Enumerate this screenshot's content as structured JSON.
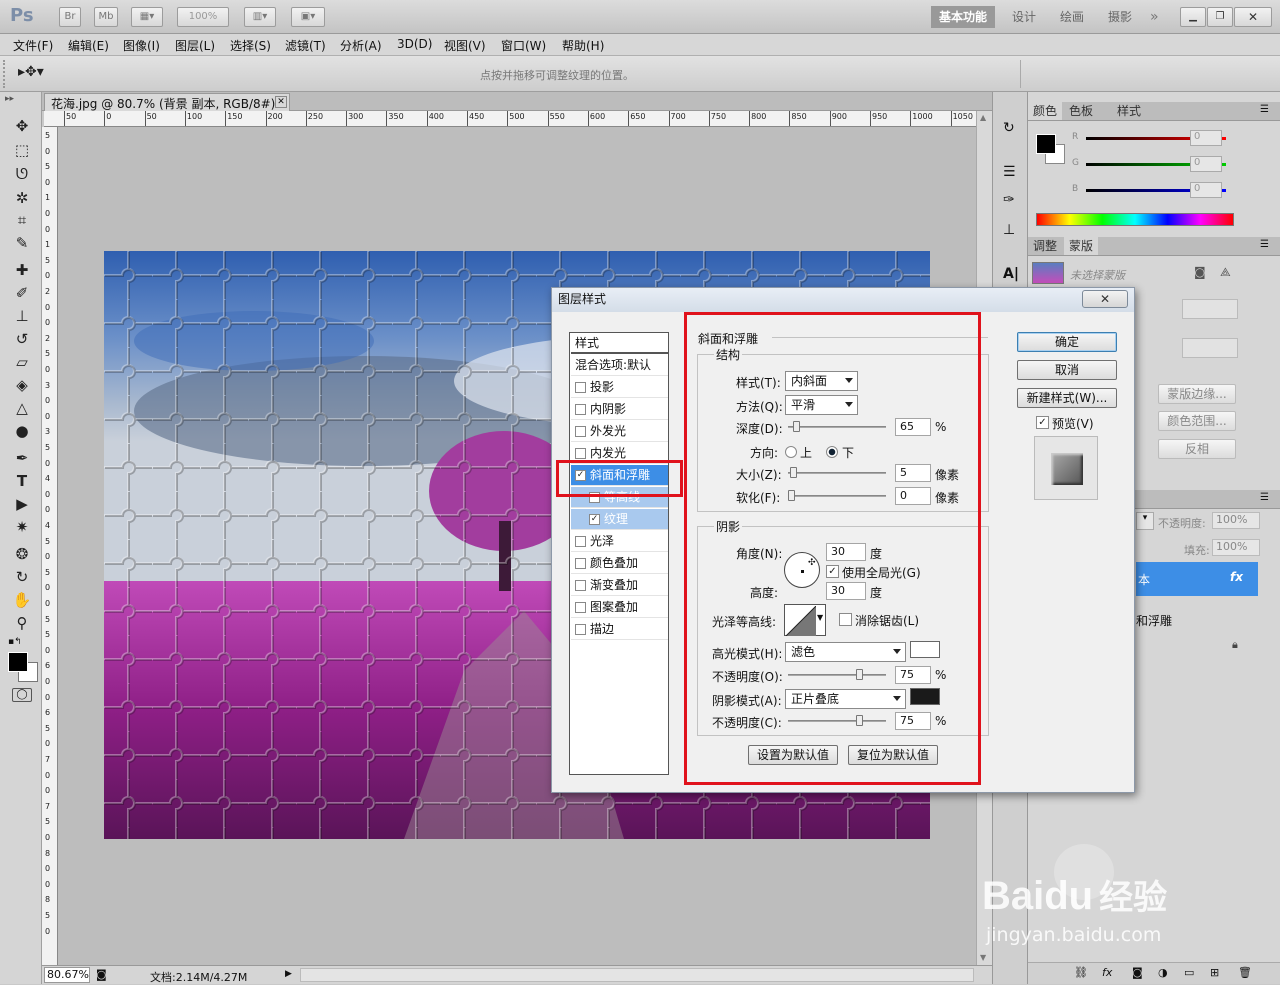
{
  "app": {
    "logo": "Ps",
    "zoom_display": "100%",
    "workspace": [
      "基本功能",
      "设计",
      "绘画",
      "摄影"
    ],
    "bridge_label": "Br",
    "minibridge_label": "Mb"
  },
  "menu": [
    "文件(F)",
    "编辑(E)",
    "图像(I)",
    "图层(L)",
    "选择(S)",
    "滤镜(T)",
    "分析(A)",
    "3D(D)",
    "视图(V)",
    "窗口(W)",
    "帮助(H)"
  ],
  "options_hint": "点按并拖移可调整纹理的位置。",
  "document": {
    "tab": "花海.jpg @ 80.7% (背景 副本, RGB/8#) *",
    "zoom": "80.67%",
    "doc_info": "文档:2.14M/4.27M",
    "ruler_h": [
      "50",
      "0",
      "50",
      "100",
      "150",
      "200",
      "250",
      "300",
      "350",
      "400",
      "450",
      "500",
      "550",
      "600",
      "650",
      "700",
      "750",
      "800",
      "850",
      "900",
      "950",
      "1000",
      "1050"
    ],
    "ruler_v": [
      "5",
      "0",
      "5",
      "0",
      "1",
      "0",
      "0",
      "1",
      "5",
      "0",
      "2",
      "0",
      "0",
      "2",
      "5",
      "0",
      "3",
      "0",
      "0",
      "3",
      "5",
      "0",
      "4",
      "0",
      "0",
      "4",
      "5",
      "0",
      "5",
      "0",
      "0",
      "5",
      "5",
      "0",
      "6",
      "0",
      "0",
      "6",
      "5",
      "0",
      "7",
      "0",
      "0",
      "7",
      "5",
      "0",
      "8",
      "0",
      "0",
      "8",
      "5",
      "0"
    ]
  },
  "color_panel": {
    "tabs": [
      "颜色",
      "色板",
      "样式"
    ],
    "channels": [
      {
        "label": "R",
        "value": "0"
      },
      {
        "label": "G",
        "value": "0"
      },
      {
        "label": "B",
        "value": "0"
      }
    ]
  },
  "adjust_panel": {
    "tabs": [
      "调整",
      "蒙版"
    ],
    "mask_status": "未选择蒙版",
    "buttons": [
      "蒙版边缘...",
      "颜色范围...",
      "反相"
    ]
  },
  "layers_panel": {
    "opacity_label": "不透明度:",
    "opacity_value": "100%",
    "fill_label": "填充:",
    "fill_value": "100%",
    "layer_name": "本",
    "fx": "fx",
    "effect_name": "和浮雕"
  },
  "dialog": {
    "title": "图层样式",
    "close": "✕",
    "list_header": "样式",
    "list": [
      {
        "label": "混合选项:默认",
        "checkbox": false,
        "checked": false
      },
      {
        "label": "投影",
        "checkbox": true,
        "checked": false
      },
      {
        "label": "内阴影",
        "checkbox": true,
        "checked": false
      },
      {
        "label": "外发光",
        "checkbox": true,
        "checked": false
      },
      {
        "label": "内发光",
        "checkbox": true,
        "checked": false
      },
      {
        "label": "斜面和浮雕",
        "checkbox": true,
        "checked": true,
        "selected": true
      },
      {
        "label": "等高线",
        "checkbox": true,
        "checked": false,
        "sub": true
      },
      {
        "label": "纹理",
        "checkbox": true,
        "checked": true,
        "sub": true
      },
      {
        "label": "光泽",
        "checkbox": true,
        "checked": false
      },
      {
        "label": "颜色叠加",
        "checkbox": true,
        "checked": false
      },
      {
        "label": "渐变叠加",
        "checkbox": true,
        "checked": false
      },
      {
        "label": "图案叠加",
        "checkbox": true,
        "checked": false
      },
      {
        "label": "描边",
        "checkbox": true,
        "checked": false
      }
    ],
    "section_title": "斜面和浮雕",
    "structure": {
      "title": "结构",
      "style_label": "样式(T):",
      "style_value": "内斜面",
      "technique_label": "方法(Q):",
      "technique_value": "平滑",
      "depth_label": "深度(D):",
      "depth_value": "65",
      "depth_unit": "%",
      "depth_frac": 0.06,
      "direction_label": "方向:",
      "dir_up": "上",
      "dir_down": "下",
      "size_label": "大小(Z):",
      "size_value": "5",
      "size_unit": "像素",
      "size_frac": 0.02,
      "soften_label": "软化(F):",
      "soften_value": "0",
      "soften_unit": "像素",
      "soften_frac": 0.0
    },
    "shading": {
      "title": "阴影",
      "angle_label": "角度(N):",
      "angle_value": "30",
      "angle_unit": "度",
      "global_light": "使用全局光(G)",
      "altitude_label": "高度:",
      "altitude_value": "30",
      "altitude_unit": "度",
      "gloss_label": "光泽等高线:",
      "antialias": "消除锯齿(L)",
      "highlight_label": "高光模式(H):",
      "highlight_mode": "滤色",
      "highlight_color": "#ffffff",
      "hl_opacity_label": "不透明度(O):",
      "hl_opacity_value": "75",
      "hl_frac": 0.75,
      "shadow_label": "阴影模式(A):",
      "shadow_mode": "正片叠底",
      "shadow_color": "#1a1a1a",
      "sh_opacity_label": "不透明度(C):",
      "sh_opacity_value": "75",
      "sh_frac": 0.75,
      "percent": "%"
    },
    "btn_make_default": "设置为默认值",
    "btn_reset_default": "复位为默认值",
    "btn_ok": "确定",
    "btn_cancel": "取消",
    "btn_new_style": "新建样式(W)...",
    "preview_label": "预览(V)"
  },
  "watermark": {
    "brand": "Bai",
    "brand2": "du",
    "cn": "经验",
    "url": "jingyan.baidu.com"
  }
}
